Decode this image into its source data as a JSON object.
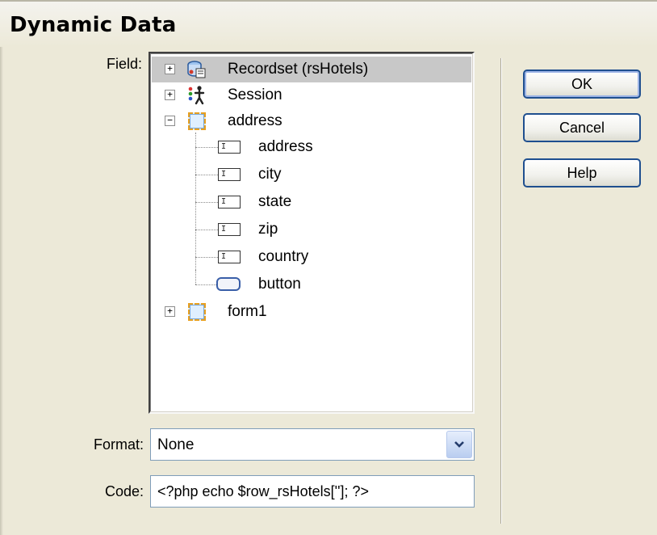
{
  "dialog": {
    "title": "Dynamic Data"
  },
  "labels": {
    "field": "Field:",
    "format": "Format:",
    "code": "Code:"
  },
  "tree": {
    "recordset": "Recordset (rsHotels)",
    "session": "Session",
    "address_form": "address",
    "children": [
      "address",
      "city",
      "state",
      "zip",
      "country",
      "button"
    ],
    "form1": "form1"
  },
  "format": {
    "value": "None"
  },
  "code": {
    "value": "<?php echo $row_rsHotels['']; ?>"
  },
  "buttons": {
    "ok": "OK",
    "cancel": "Cancel",
    "help": "Help"
  },
  "icons": {
    "recordset": "recordset-icon",
    "session": "session-icon",
    "form": "form-icon",
    "textfield": "text-field-icon",
    "button": "button-icon",
    "dropdown": "chevron-down-icon"
  }
}
